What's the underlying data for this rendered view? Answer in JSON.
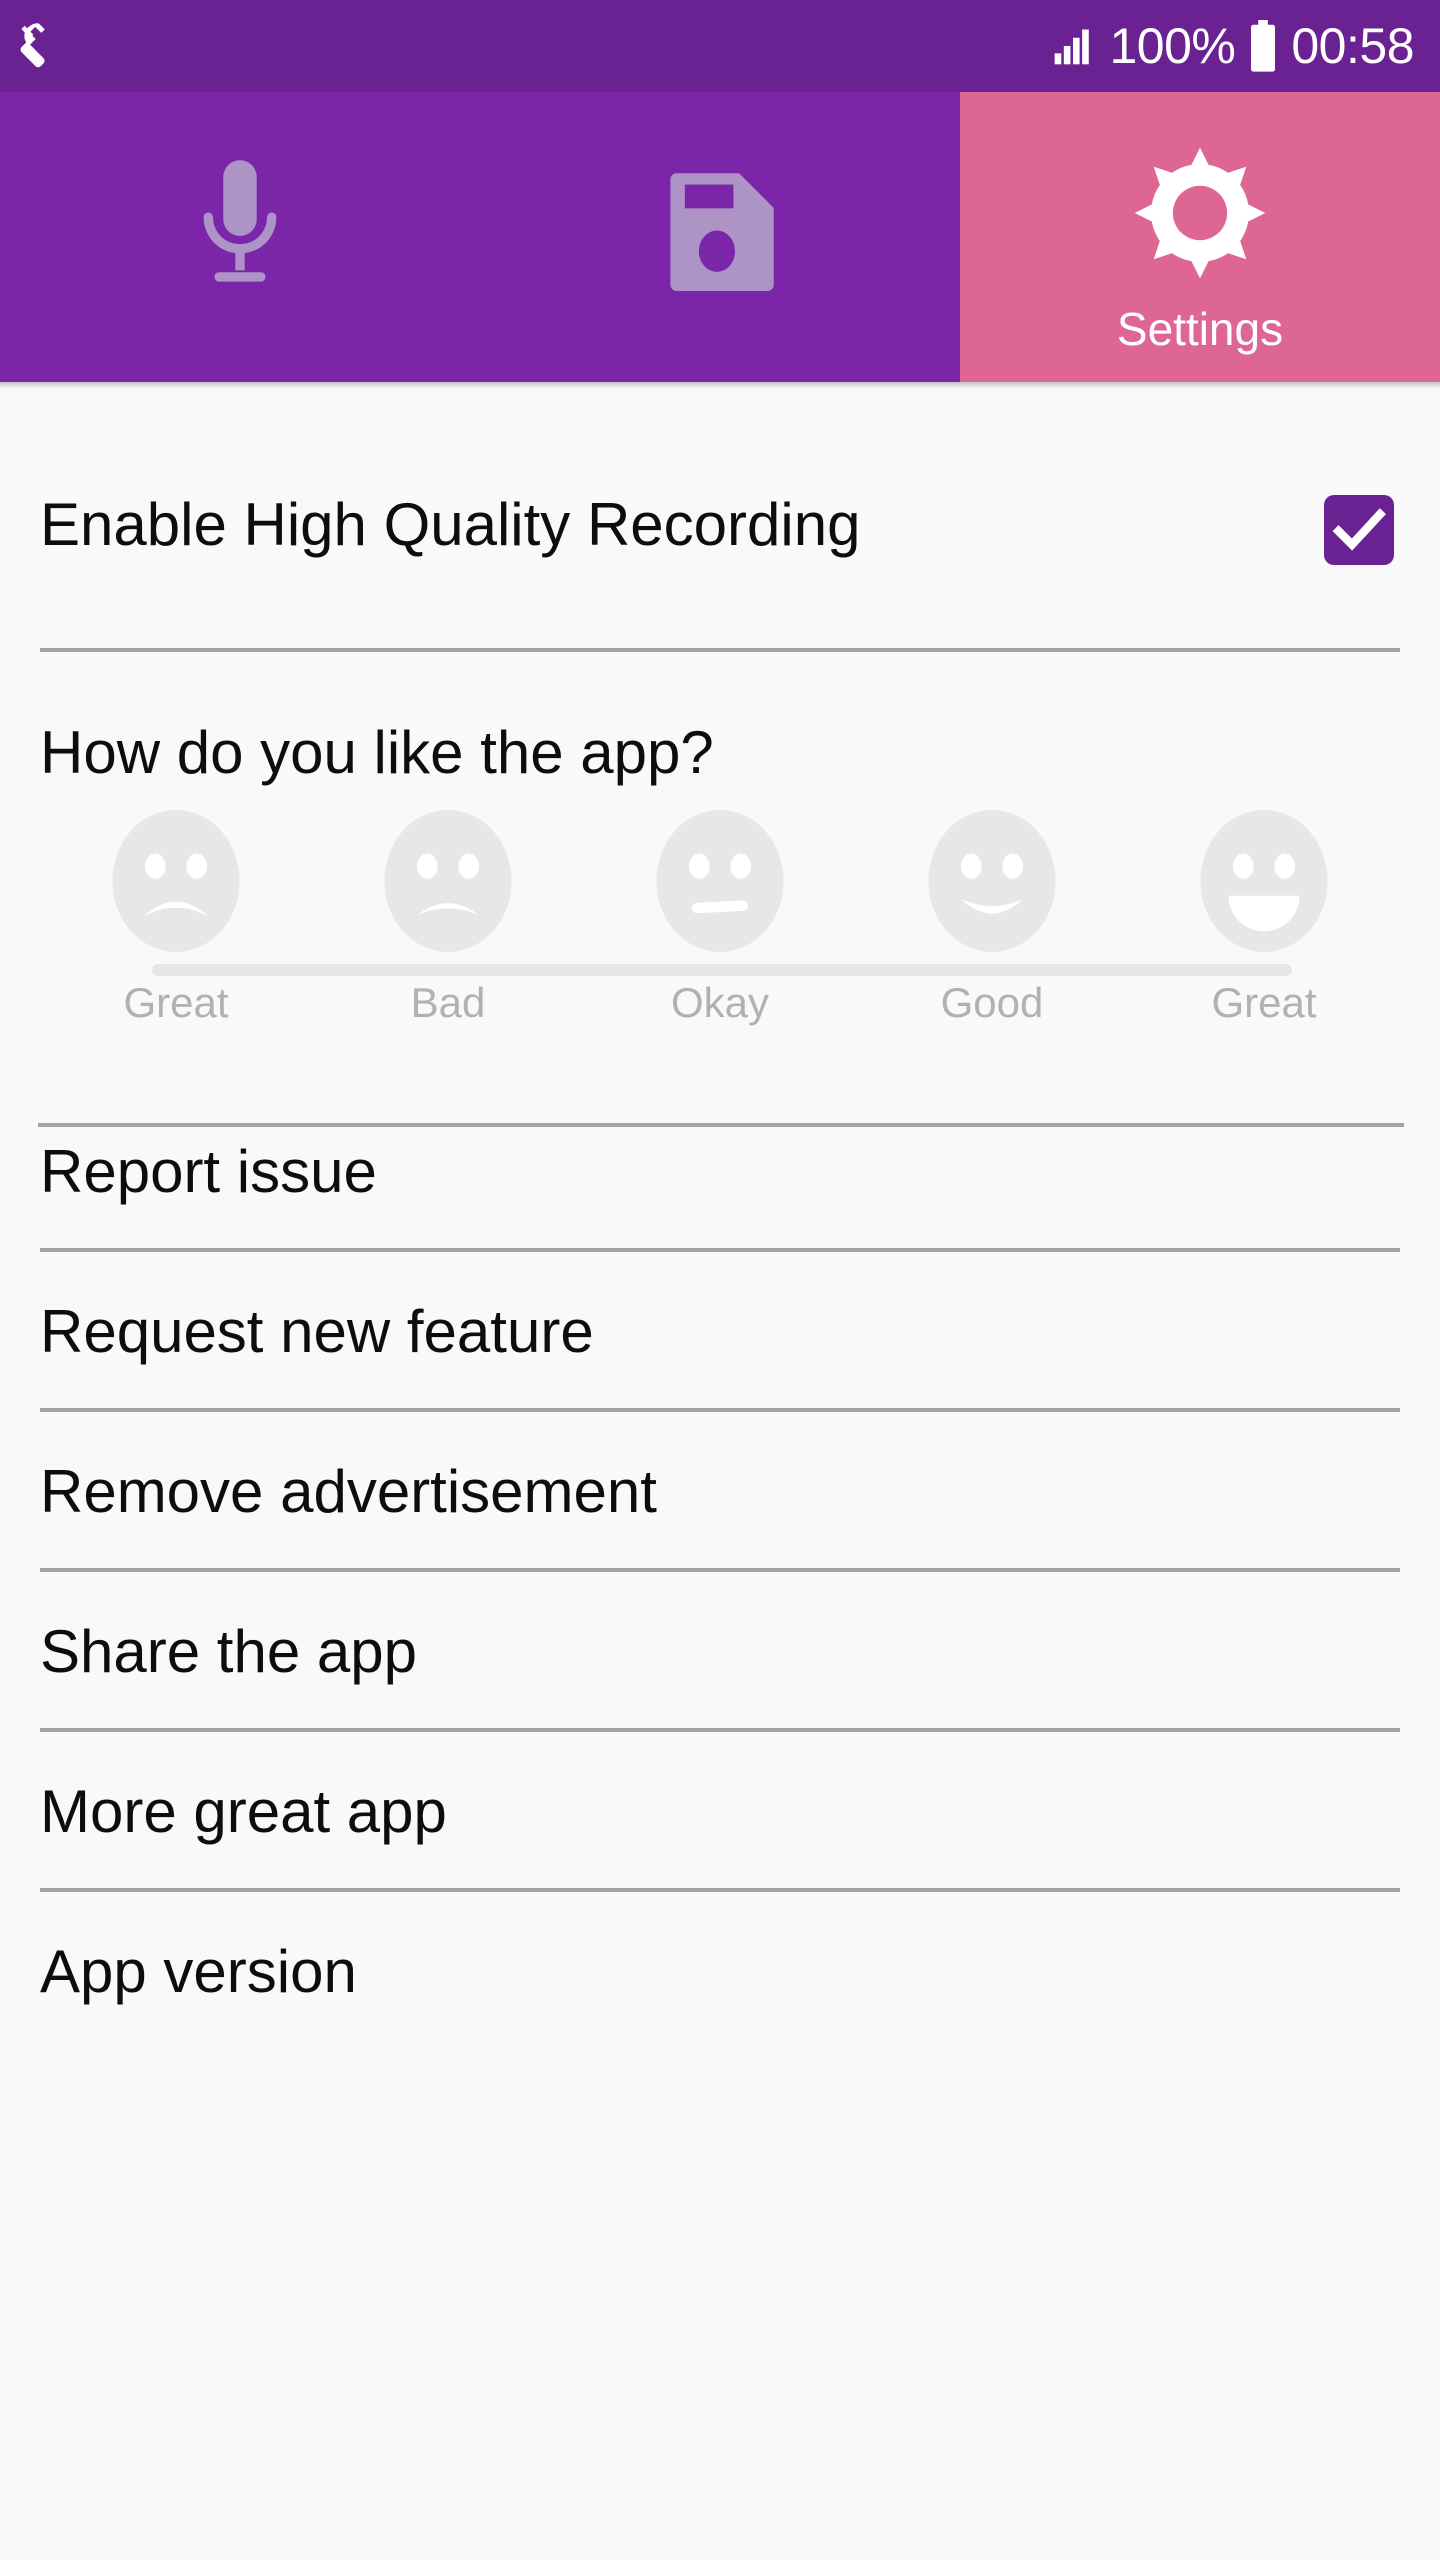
{
  "status_bar": {
    "notification_icon": "wrench-icon",
    "signal_icon": "signal-bars-icon",
    "battery_percent": "100%",
    "battery_icon": "battery-full-icon",
    "clock": "00:58"
  },
  "tabs": [
    {
      "id": "record",
      "label": "",
      "icon": "microphone-icon",
      "active": false
    },
    {
      "id": "save",
      "label": "",
      "icon": "floppy-disk-save-icon",
      "active": false
    },
    {
      "id": "settings",
      "label": "Settings",
      "icon": "gear-icon",
      "active": true
    }
  ],
  "settings": {
    "high_quality": {
      "label": "Enable High Quality Recording",
      "checked": true
    },
    "rating": {
      "question": "How do you like the app?",
      "options": [
        {
          "label": "Great",
          "face": "very-sad-face-icon"
        },
        {
          "label": "Bad",
          "face": "sad-face-icon"
        },
        {
          "label": "Okay",
          "face": "neutral-face-icon"
        },
        {
          "label": "Good",
          "face": "happy-face-icon"
        },
        {
          "label": "Great",
          "face": "very-happy-face-icon"
        }
      ],
      "selected": null
    },
    "items": [
      {
        "label": "Report issue"
      },
      {
        "label": "Request new feature"
      },
      {
        "label": "Remove advertisement"
      },
      {
        "label": "Share the app"
      },
      {
        "label": "More great app"
      },
      {
        "label": "App version"
      }
    ]
  },
  "colors": {
    "status_bar": "#6a2192",
    "tab_inactive": "#7b26a8",
    "tab_active": "#de6695",
    "accent_checkbox": "#6a2192",
    "content_bg": "#f9f9f9",
    "divider": "#a3a3a3",
    "smiley_face": "#e6e7e9",
    "smiley_label": "#b0b1b5",
    "text": "#0d0d0d"
  }
}
